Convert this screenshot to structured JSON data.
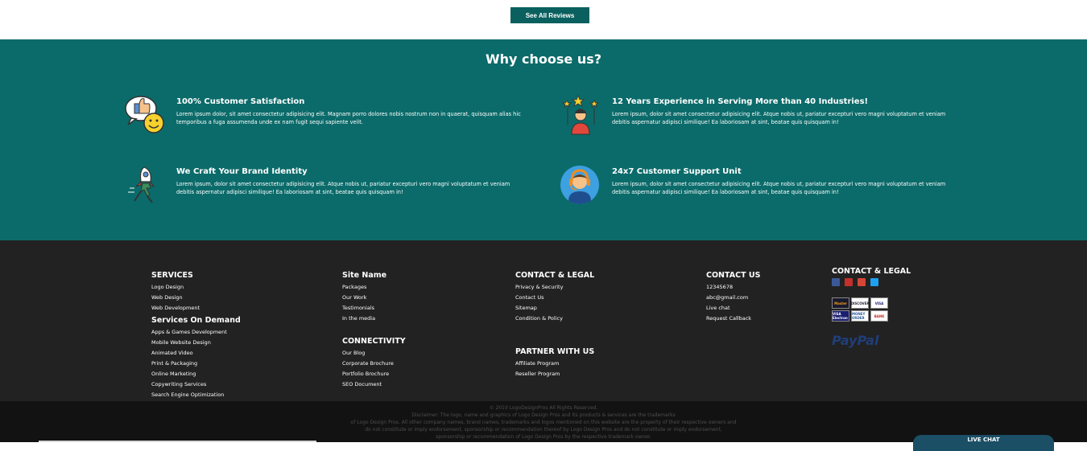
{
  "reviews": {
    "button_label": "See All Reviews"
  },
  "why": {
    "title": "Why choose us?",
    "features": [
      {
        "title": "100% Customer Satisfaction",
        "desc": "Lorem ipsum dolor, sit amet consectetur adipisicing elit. Magnam porro dolores nobis nostrum non in quaerat, quisquam alias hic temporibus a fuga assumenda unde ex nam fugit sequi sapiente velit.",
        "icon": "thumbs-up-smiley-icon"
      },
      {
        "title": "12 Years Experience in Serving More than 40 Industries!",
        "desc": "Lorem ipsum, dolor sit amet consectetur adipisicing elit. Atque nobis ut, pariatur excepturi vero magni voluptatum et veniam debitis aspernatur adipisci similique! Ea laboriosam at sint, beatae quis quisquam in!",
        "icon": "star-person-icon"
      },
      {
        "title": "We Craft Your Brand Identity",
        "desc": "Lorem ipsum, dolor sit amet consectetur adipisicing elit. Atque nobis ut, pariatur excepturi vero magni voluptatum et veniam debitis aspernatur adipisci similique! Ea laboriosam at sint, beatae quis quisquam in!",
        "icon": "rocket-runner-icon"
      },
      {
        "title": "24x7 Customer Support Unit",
        "desc": "Lorem ipsum, dolor sit amet consectetur adipisicing elit. Atque nobis ut, pariatur excepturi vero magni voluptatum et veniam debitis aspernatur adipisci similique! Ea laboriosam at sint, beatae quis quisquam in!",
        "icon": "headset-support-icon"
      }
    ]
  },
  "footer": {
    "services": {
      "title": "SERVICES",
      "items": [
        "Logo Design",
        "Web Design",
        "Web Development"
      ]
    },
    "services_on_demand": {
      "title": "Services On Demand",
      "items": [
        "Apps & Games Development",
        "Mobile Website Design",
        "Animated Video",
        "Print & Packaging",
        "Online Marketing",
        "Copywriting Services",
        "Search Engine Optimization"
      ]
    },
    "site_name": {
      "title": "Site Name",
      "items": [
        "Packages",
        "Our Work",
        "Testimonials",
        "In the media"
      ]
    },
    "connectivity": {
      "title": "CONNECTIVITY",
      "items": [
        "Our Blog",
        "Corporate Brochure",
        "Portfolio Brochure",
        "SEO Document"
      ]
    },
    "contact_legal": {
      "title": "CONTACT & LEGAL",
      "items": [
        "Privacy & Security",
        "Contact Us",
        "Sitemap",
        "Condition & Policy"
      ]
    },
    "partner": {
      "title": "PARTNER WITH US",
      "items": [
        "Affiliate Program",
        "Reseller Program"
      ]
    },
    "contact_us": {
      "title": "CONTACT US",
      "items": [
        "12345678",
        "abc@gmail.com",
        "Live chat",
        "Request Callback"
      ]
    },
    "contact_legal_2": {
      "title": "CONTACT & LEGAL",
      "social": [
        {
          "icon": "facebook-icon",
          "color": "#3b5998"
        },
        {
          "icon": "youtube-icon",
          "color": "#c4302b"
        },
        {
          "icon": "mail-icon",
          "color": "#d44638"
        },
        {
          "icon": "twitter-icon",
          "color": "#1da1f2"
        }
      ],
      "cards": [
        "Master",
        "DISCOVER",
        "VISA",
        "VISA Electron",
        "MONEY ORDER",
        "BANK"
      ],
      "paypal": "PayPal"
    }
  },
  "bottom": {
    "copyright": "© 2019 LogoDesignPros All Rights Reserved.",
    "disclaimer_1": "Disclaimer: The logo, name and graphics of Logo Design Pros and its products & services are the trademarks",
    "disclaimer_2": "of Logo Design Pros. All other company names, brand names, trademarks and logos mentioned on this website are the property of their respective owners and",
    "disclaimer_3": "do not constitute or imply endorsement, sponsorship or recommendation thereof by Logo Design Pros and do not constitute or imply endorsement,",
    "disclaimer_4": "sponsorship or recommendation of Logo Design Pros by the respective trademark owner."
  },
  "live_chat": {
    "label": "LIVE CHAT"
  }
}
